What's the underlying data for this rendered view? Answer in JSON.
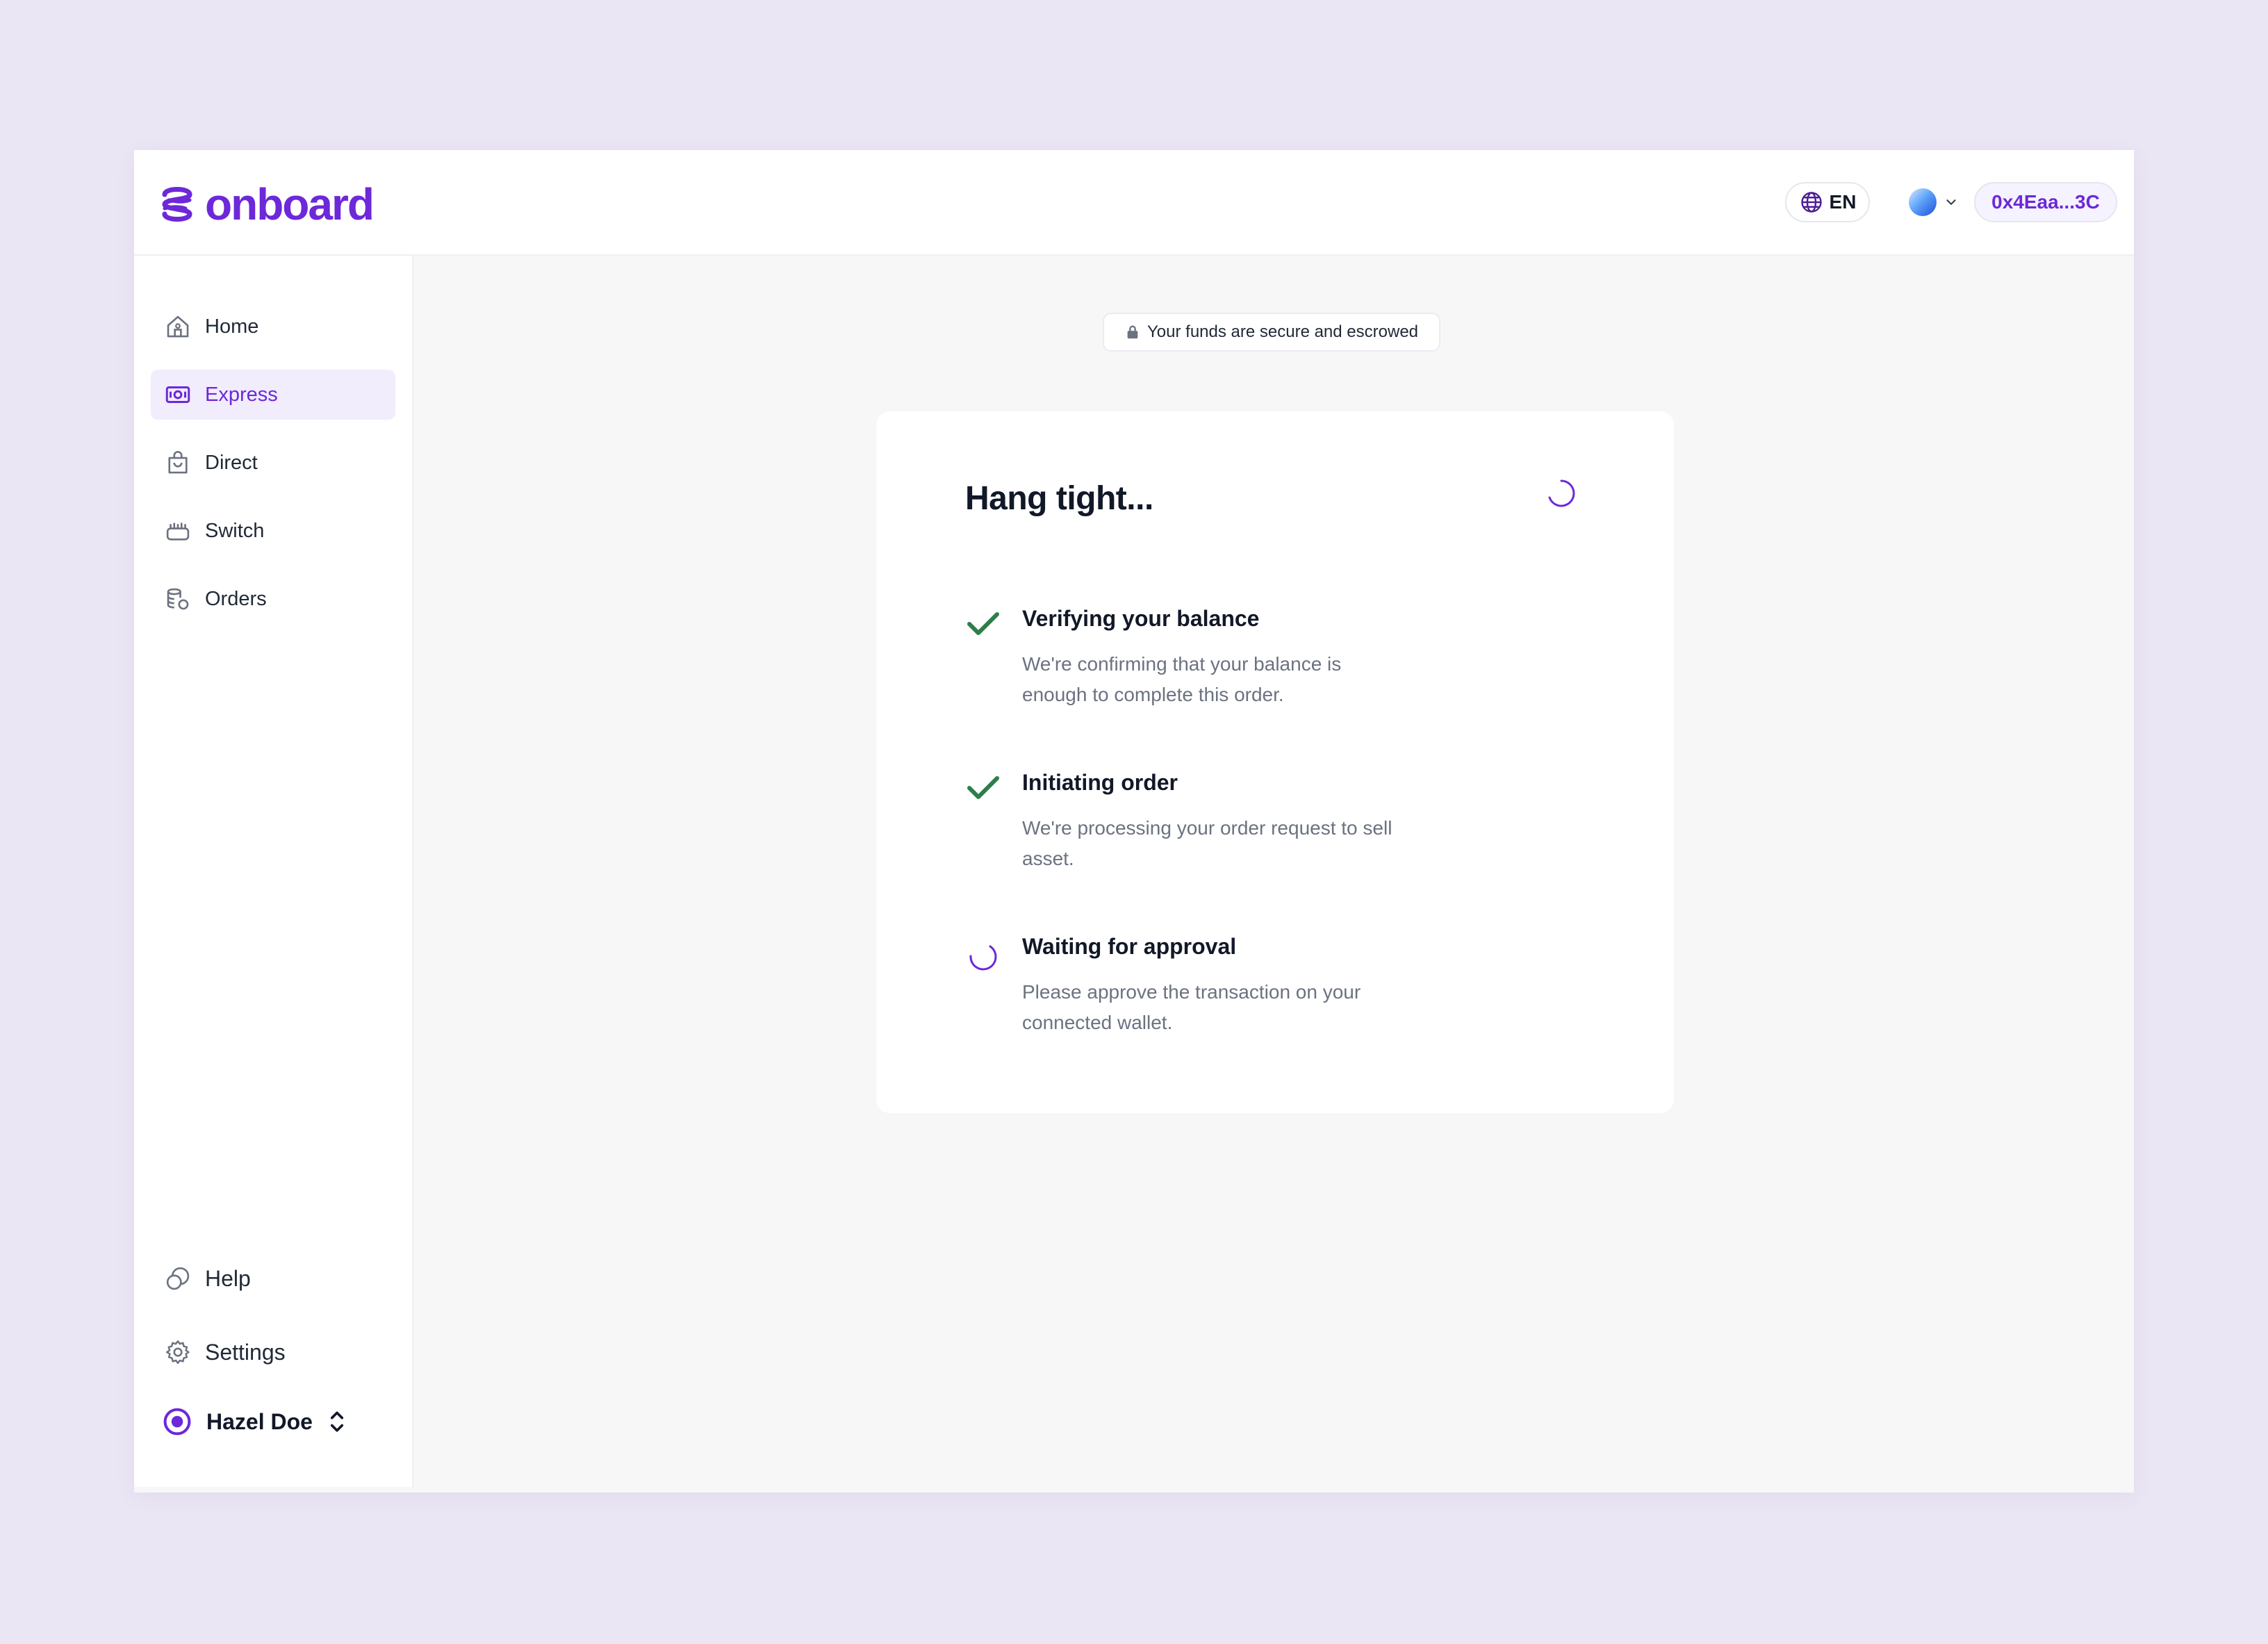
{
  "app": {
    "logo_text": "onboard",
    "brand_color": "#6d28d9"
  },
  "header": {
    "language": "EN",
    "wallet_address": "0x4Eaa...3C"
  },
  "sidebar": {
    "items": [
      {
        "label": "Home",
        "icon": "home-icon"
      },
      {
        "label": "Express",
        "icon": "express-icon",
        "active": true
      },
      {
        "label": "Direct",
        "icon": "direct-icon"
      },
      {
        "label": "Switch",
        "icon": "switch-icon"
      },
      {
        "label": "Orders",
        "icon": "orders-icon"
      }
    ],
    "bottom_items": [
      {
        "label": "Help",
        "icon": "help-icon"
      },
      {
        "label": "Settings",
        "icon": "gear-icon"
      }
    ],
    "user_name": "Hazel Doe"
  },
  "secure_badge": "Your funds are secure and escrowed",
  "card": {
    "title": "Hang tight...",
    "steps": [
      {
        "title": "Verifying your balance",
        "description": "We're confirming that your balance is enough to complete this order.",
        "status": "complete"
      },
      {
        "title": "Initiating order",
        "description": "We're processing your order request to sell asset.",
        "status": "complete"
      },
      {
        "title": "Waiting for approval",
        "description": "Please approve the transaction on your connected wallet.",
        "status": "loading"
      }
    ]
  },
  "colors": {
    "success": "#2f7d4a",
    "accent": "#6d28d9",
    "background": "#ebe6f4"
  }
}
